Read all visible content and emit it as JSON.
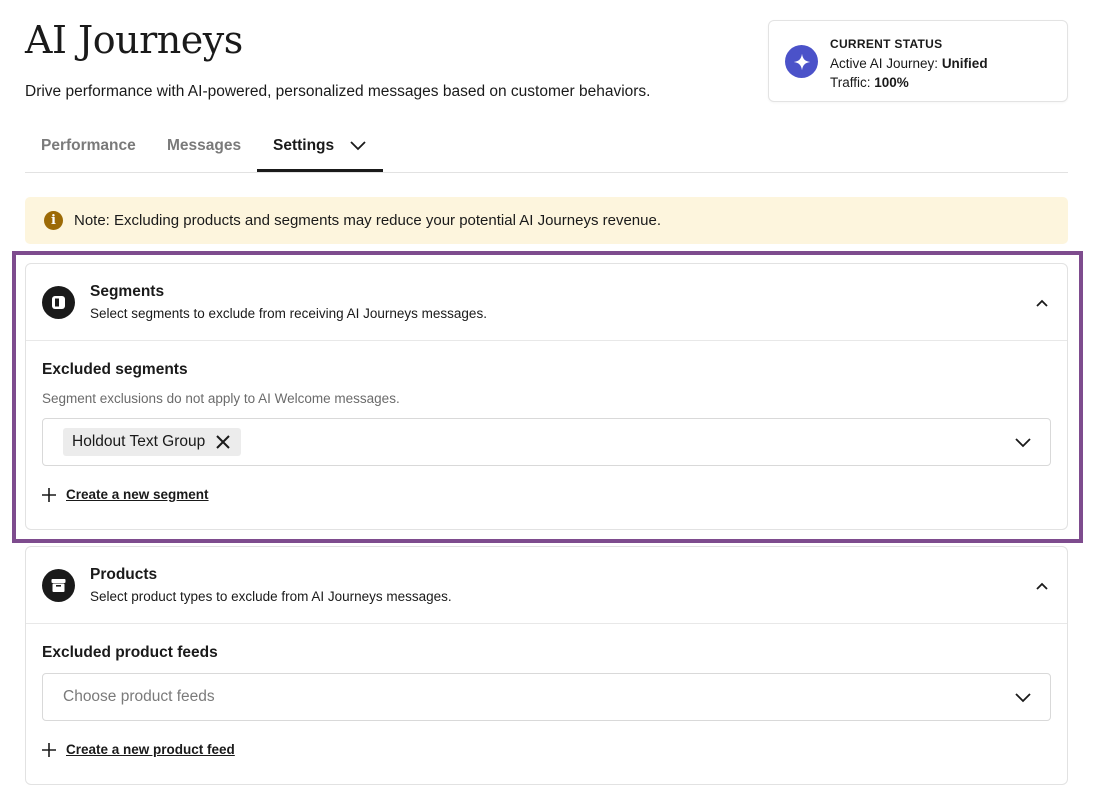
{
  "header": {
    "title": "AI Journeys",
    "subtitle": "Drive performance with AI-powered, personalized messages based on customer behaviors."
  },
  "status": {
    "heading": "CURRENT STATUS",
    "journey_label": "Active AI Journey: ",
    "journey_value": "Unified",
    "traffic_label": "Traffic: ",
    "traffic_value": "100%",
    "icon": "sparkle-icon",
    "icon_color": "#4b52c9"
  },
  "tabs": [
    {
      "label": "Performance",
      "active": false
    },
    {
      "label": "Messages",
      "active": false
    },
    {
      "label": "Settings",
      "active": true,
      "has_dropdown": true
    }
  ],
  "note": {
    "text": "Note: Excluding products and segments may reduce your potential AI Journeys revenue.",
    "icon": "info-icon",
    "bg_color": "#fdf5dd"
  },
  "segments": {
    "title": "Segments",
    "description": "Select segments to exclude from receiving AI Journeys messages.",
    "field_label": "Excluded segments",
    "help_text": "Segment exclusions do not apply to AI Welcome messages.",
    "selected": [
      "Holdout Text Group"
    ],
    "create_link": "Create a new segment",
    "highlight_color": "#7e4c8e"
  },
  "products": {
    "title": "Products",
    "description": "Select product types to exclude from AI Journeys messages.",
    "field_label": "Excluded product feeds",
    "placeholder": "Choose product feeds",
    "create_link": "Create a new product feed"
  }
}
